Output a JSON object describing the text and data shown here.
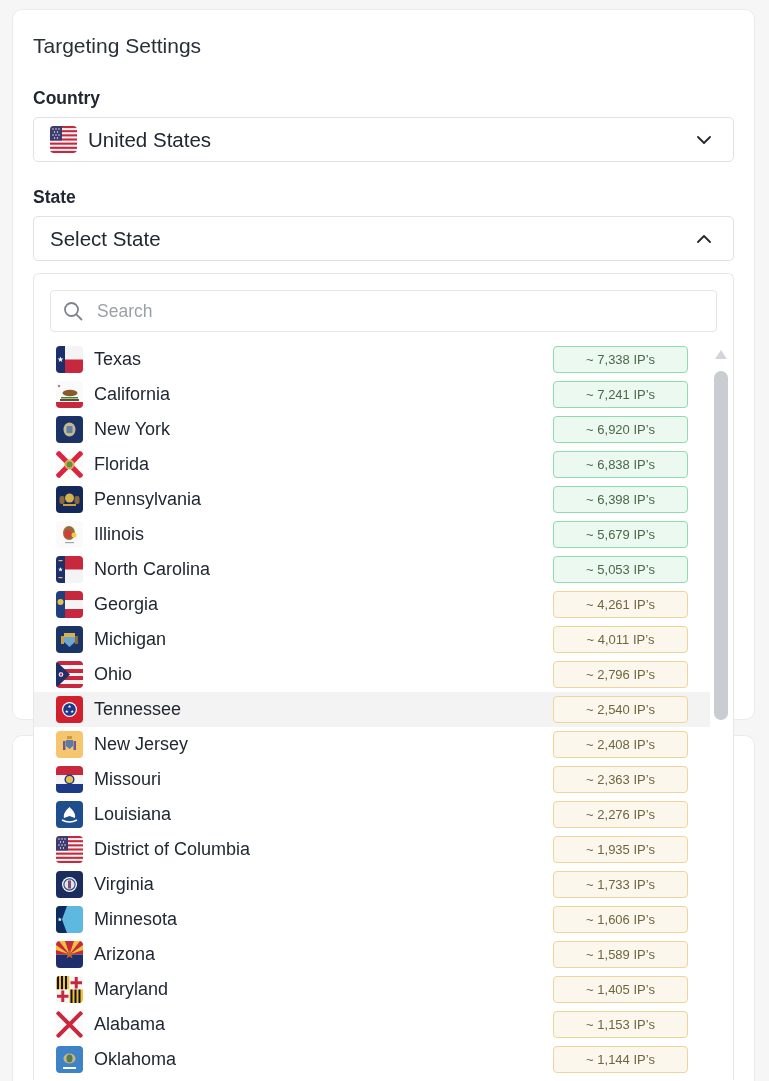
{
  "panel": {
    "title": "Targeting Settings"
  },
  "country": {
    "label": "Country",
    "value": "United States",
    "expanded": false
  },
  "state": {
    "label": "State",
    "placeholder": "Select State",
    "expanded": true
  },
  "dropdown": {
    "search": {
      "placeholder": "Search"
    },
    "options": [
      {
        "name": "Texas",
        "count": "~ 7,338 IP’s",
        "color": "#8fdcaf",
        "highlighted": false
      },
      {
        "name": "California",
        "count": "~ 7,241 IP’s",
        "color": "#8fdcaf",
        "highlighted": false
      },
      {
        "name": "New York",
        "count": "~ 6,920 IP’s",
        "color": "#8fdcaf",
        "highlighted": false
      },
      {
        "name": "Florida",
        "count": "~ 6,838 IP’s",
        "color": "#8fdcaf",
        "highlighted": false
      },
      {
        "name": "Pennsylvania",
        "count": "~ 6,398 IP’s",
        "color": "#8fdcaf",
        "highlighted": false
      },
      {
        "name": "Illinois",
        "count": "~ 5,679 IP’s",
        "color": "#8fdcaf",
        "highlighted": false
      },
      {
        "name": "North Carolina",
        "count": "~ 5,053 IP’s",
        "color": "#8fdcaf",
        "highlighted": false
      },
      {
        "name": "Georgia",
        "count": "~ 4,261 IP’s",
        "color": "#f0d59b",
        "highlighted": false
      },
      {
        "name": "Michigan",
        "count": "~ 4,011 IP’s",
        "color": "#f0d59b",
        "highlighted": false
      },
      {
        "name": "Ohio",
        "count": "~ 2,796 IP’s",
        "color": "#f0d59b",
        "highlighted": false
      },
      {
        "name": "Tennessee",
        "count": "~ 2,540 IP’s",
        "color": "#f0d59b",
        "highlighted": true
      },
      {
        "name": "New Jersey",
        "count": "~ 2,408 IP’s",
        "color": "#f0d59b",
        "highlighted": false
      },
      {
        "name": "Missouri",
        "count": "~ 2,363 IP’s",
        "color": "#f0d59b",
        "highlighted": false
      },
      {
        "name": "Louisiana",
        "count": "~ 2,276 IP’s",
        "color": "#f0d59b",
        "highlighted": false
      },
      {
        "name": "District of Columbia",
        "count": "~ 1,935 IP’s",
        "color": "#f0d59b",
        "highlighted": false
      },
      {
        "name": "Virginia",
        "count": "~ 1,733 IP’s",
        "color": "#f0d59b",
        "highlighted": false
      },
      {
        "name": "Minnesota",
        "count": "~ 1,606 IP’s",
        "color": "#f0d59b",
        "highlighted": false
      },
      {
        "name": "Arizona",
        "count": "~ 1,589 IP’s",
        "color": "#f0d59b",
        "highlighted": false
      },
      {
        "name": "Maryland",
        "count": "~ 1,405 IP’s",
        "color": "#f0d59b",
        "highlighted": false
      },
      {
        "name": "Alabama",
        "count": "~ 1,153 IP’s",
        "color": "#f0d59b",
        "highlighted": false
      },
      {
        "name": "Oklahoma",
        "count": "~ 1,144 IP’s",
        "color": "#f0d59b",
        "highlighted": false
      }
    ]
  }
}
